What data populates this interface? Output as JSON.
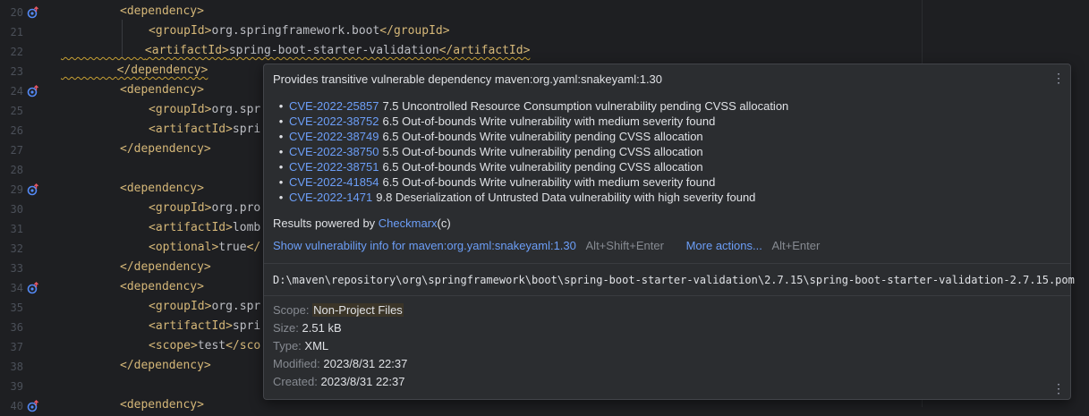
{
  "editor": {
    "lines": [
      {
        "n": "20",
        "icon": true
      },
      {
        "n": "21",
        "icon": false
      },
      {
        "n": "22",
        "icon": false
      },
      {
        "n": "23",
        "icon": false
      },
      {
        "n": "24",
        "icon": true
      },
      {
        "n": "25",
        "icon": false
      },
      {
        "n": "26",
        "icon": false
      },
      {
        "n": "27",
        "icon": false
      },
      {
        "n": "28",
        "icon": false
      },
      {
        "n": "29",
        "icon": true
      },
      {
        "n": "30",
        "icon": false
      },
      {
        "n": "31",
        "icon": false
      },
      {
        "n": "32",
        "icon": false
      },
      {
        "n": "33",
        "icon": false
      },
      {
        "n": "34",
        "icon": true
      },
      {
        "n": "35",
        "icon": false
      },
      {
        "n": "36",
        "icon": false
      },
      {
        "n": "37",
        "icon": false
      },
      {
        "n": "38",
        "icon": false
      },
      {
        "n": "39",
        "icon": false
      },
      {
        "n": "40",
        "icon": true
      }
    ],
    "code": {
      "l20": "<dependency>",
      "l21_open": "<groupId>",
      "l21_val": "org.springframework.boot",
      "l21_close": "</groupId>",
      "l22_open": "<artifactId>",
      "l22_val": "spring-boot-starter-validation",
      "l22_close": "</artifactId>",
      "l23": "</dependency>",
      "l24": "<dependency>",
      "l25_open": "<groupId>",
      "l25_val": "org.spr",
      "l26_open": "<artifactId>",
      "l26_val": "spri",
      "l27": "</dependency>",
      "l29": "<dependency>",
      "l30_open": "<groupId>",
      "l30_val": "org.pro",
      "l31_open": "<artifactId>",
      "l31_val": "lomb",
      "l32_open": "<optional>",
      "l32_val": "true",
      "l32_close": "</",
      "l33": "</dependency>",
      "l34": "<dependency>",
      "l35_open": "<groupId>",
      "l35_val": "org.spr",
      "l36_open": "<artifactId>",
      "l36_val": "spri",
      "l37_open": "<scope>",
      "l37_val": "test",
      "l37_close": "</sco",
      "l38": "</dependency>",
      "l40": "<dependency>"
    }
  },
  "popup": {
    "header": "Provides transitive vulnerable dependency maven:org.yaml:snakeyaml:1.30",
    "bullet": "•",
    "cves": [
      {
        "id": "CVE-2022-25857",
        "desc": "7.5 Uncontrolled Resource Consumption vulnerability pending CVSS allocation"
      },
      {
        "id": "CVE-2022-38752",
        "desc": "6.5 Out-of-bounds Write vulnerability with medium severity found"
      },
      {
        "id": "CVE-2022-38749",
        "desc": "6.5 Out-of-bounds Write vulnerability pending CVSS allocation"
      },
      {
        "id": "CVE-2022-38750",
        "desc": "5.5 Out-of-bounds Write vulnerability pending CVSS allocation"
      },
      {
        "id": "CVE-2022-38751",
        "desc": "6.5 Out-of-bounds Write vulnerability pending CVSS allocation"
      },
      {
        "id": "CVE-2022-41854",
        "desc": "6.5 Out-of-bounds Write vulnerability with medium severity found"
      },
      {
        "id": "CVE-2022-1471",
        "desc": "9.8 Deserialization of Untrusted Data vulnerability with high severity found"
      }
    ],
    "powered_prefix": "Results powered by ",
    "powered_link": "Checkmarx",
    "powered_suffix": "(c)",
    "show_link": "Show vulnerability info for maven:org.yaml:snakeyaml:1.30",
    "show_shortcut": "Alt+Shift+Enter",
    "more_link": "More actions...",
    "more_shortcut": "Alt+Enter",
    "path": "D:\\maven\\repository\\org\\springframework\\boot\\spring-boot-starter-validation\\2.7.15\\spring-boot-starter-validation-2.7.15.pom",
    "info": {
      "scope_label": "Scope:",
      "scope_value": "Non-Project Files",
      "size_label": "Size:",
      "size_value": "2.51 kB",
      "type_label": "Type:",
      "type_value": "XML",
      "modified_label": "Modified:",
      "modified_value": "2023/8/31 22:37",
      "created_label": "Created:",
      "created_value": "2023/8/31 22:37"
    },
    "kebab": "⋮"
  },
  "colors": {
    "background": "#1e1f22",
    "popup_bg": "#2b2d30",
    "link": "#6c9ef7",
    "tag": "#d5b778",
    "warning_underline": "#c7a033"
  }
}
